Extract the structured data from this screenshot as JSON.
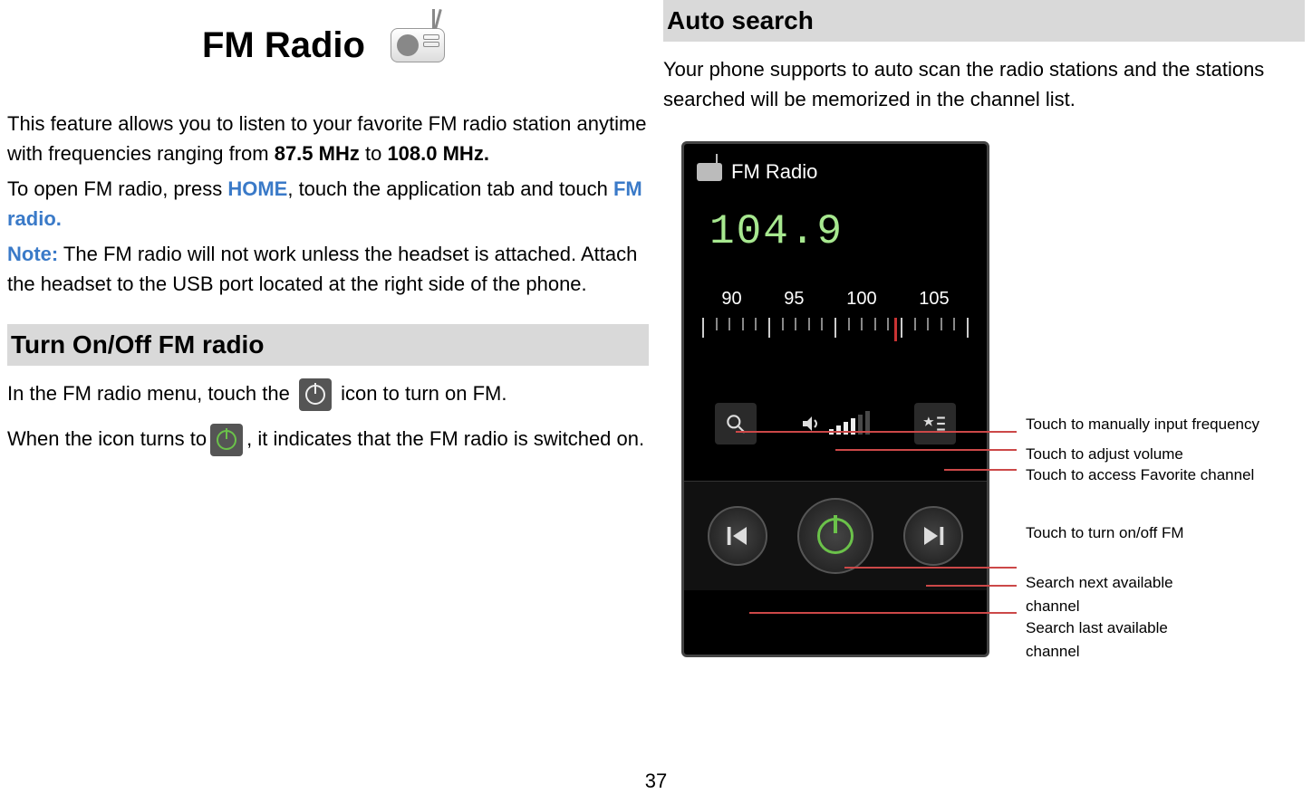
{
  "left": {
    "title": "FM Radio",
    "intro_p1_a": "This feature allows you to listen to your favorite FM radio station anytime with frequencies ranging from ",
    "intro_p1_b": "87.5 MHz",
    "intro_p1_c": " to ",
    "intro_p1_d": "108.0 MHz.",
    "intro_p2_a": "To open FM radio, press ",
    "intro_p2_home": "HOME",
    "intro_p2_b": ", touch the application tab and touch ",
    "intro_p2_fm": "FM radio.",
    "note_label": "Note:",
    "note_body": " The FM radio will not work unless the headset is attached. Attach the headset to the USB port located at the right side of the phone.",
    "section_turn": "Turn On/Off FM radio",
    "turn_a": "In the FM radio menu, touch the ",
    "turn_b": " icon to turn on FM.",
    "turn_c": "When the icon turns to",
    "turn_d": ", it indicates that the FM radio is switched on."
  },
  "right": {
    "section_auto": "Auto search",
    "auto_body": "Your phone supports to auto scan the radio stations and the stations searched will be memorized in the channel list.",
    "phone": {
      "header": "FM Radio",
      "frequency": "104.9",
      "scale_labels": [
        "90",
        "95",
        "100",
        "105"
      ]
    },
    "callouts": {
      "manual": "Touch to manually input frequency",
      "volume": "Touch to adjust volume",
      "favorite": "Touch to access Favorite channel",
      "onoff": "Touch to turn on/off FM",
      "next": "Search next available channel",
      "last": "Search last available channel"
    }
  },
  "page_number": "37"
}
